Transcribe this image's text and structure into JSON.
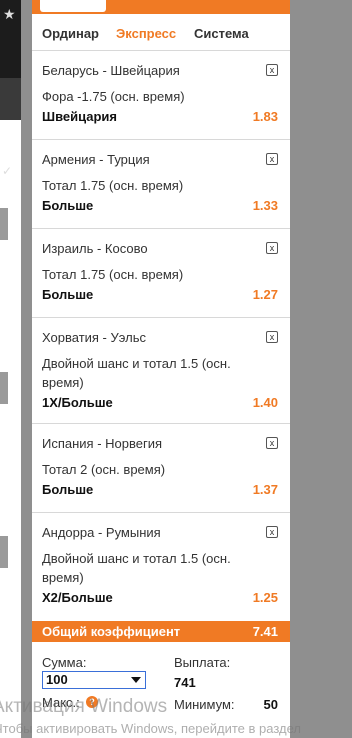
{
  "tabs": [
    {
      "label": "Ординар"
    },
    {
      "label": "Экспресс"
    },
    {
      "label": "Система"
    }
  ],
  "bets": [
    {
      "match": "Беларусь - Швейцария",
      "market": "Фора -1.75 (осн. время)",
      "selection": "Швейцария",
      "odds": "1.83",
      "close": "x"
    },
    {
      "match": "Армения - Турция",
      "market": "Тотал 1.75 (осн. время)",
      "selection": "Больше",
      "odds": "1.33",
      "close": "x"
    },
    {
      "match": "Израиль - Косово",
      "market": "Тотал 1.75 (осн. время)",
      "selection": "Больше",
      "odds": "1.27",
      "close": "x"
    },
    {
      "match": "Хорватия - Уэльс",
      "market": "Двойной шанс и тотал 1.5 (осн. время)",
      "selection": "1X/Больше",
      "odds": "1.40",
      "close": "x"
    },
    {
      "match": "Испания - Норвегия",
      "market": "Тотал 2 (осн. время)",
      "selection": "Больше",
      "odds": "1.37",
      "close": "x"
    },
    {
      "match": "Андорра - Румыния",
      "market": "Двойной шанс и тотал 1.5 (осн. время)",
      "selection": "X2/Больше",
      "odds": "1.25",
      "close": "x"
    }
  ],
  "total": {
    "label": "Общий коэффициент",
    "value": "7.41"
  },
  "form": {
    "sum_label": "Сумма:",
    "sum_value": "100",
    "payout_label": "Выплата:",
    "payout_value": "741",
    "max_label": "Макс.:",
    "help_icon": "?",
    "min_label": "Минимум:",
    "min_value": "50"
  },
  "watermark": {
    "title": "Активация Windows",
    "subtitle": "Чтобы активировать Windows, перейдите в раздел"
  },
  "side": {
    "star": "★",
    "check": "✓"
  },
  "colors": {
    "accent": "#f07a24",
    "border": "#d8d8d8",
    "input_border": "#3a6fd8"
  }
}
